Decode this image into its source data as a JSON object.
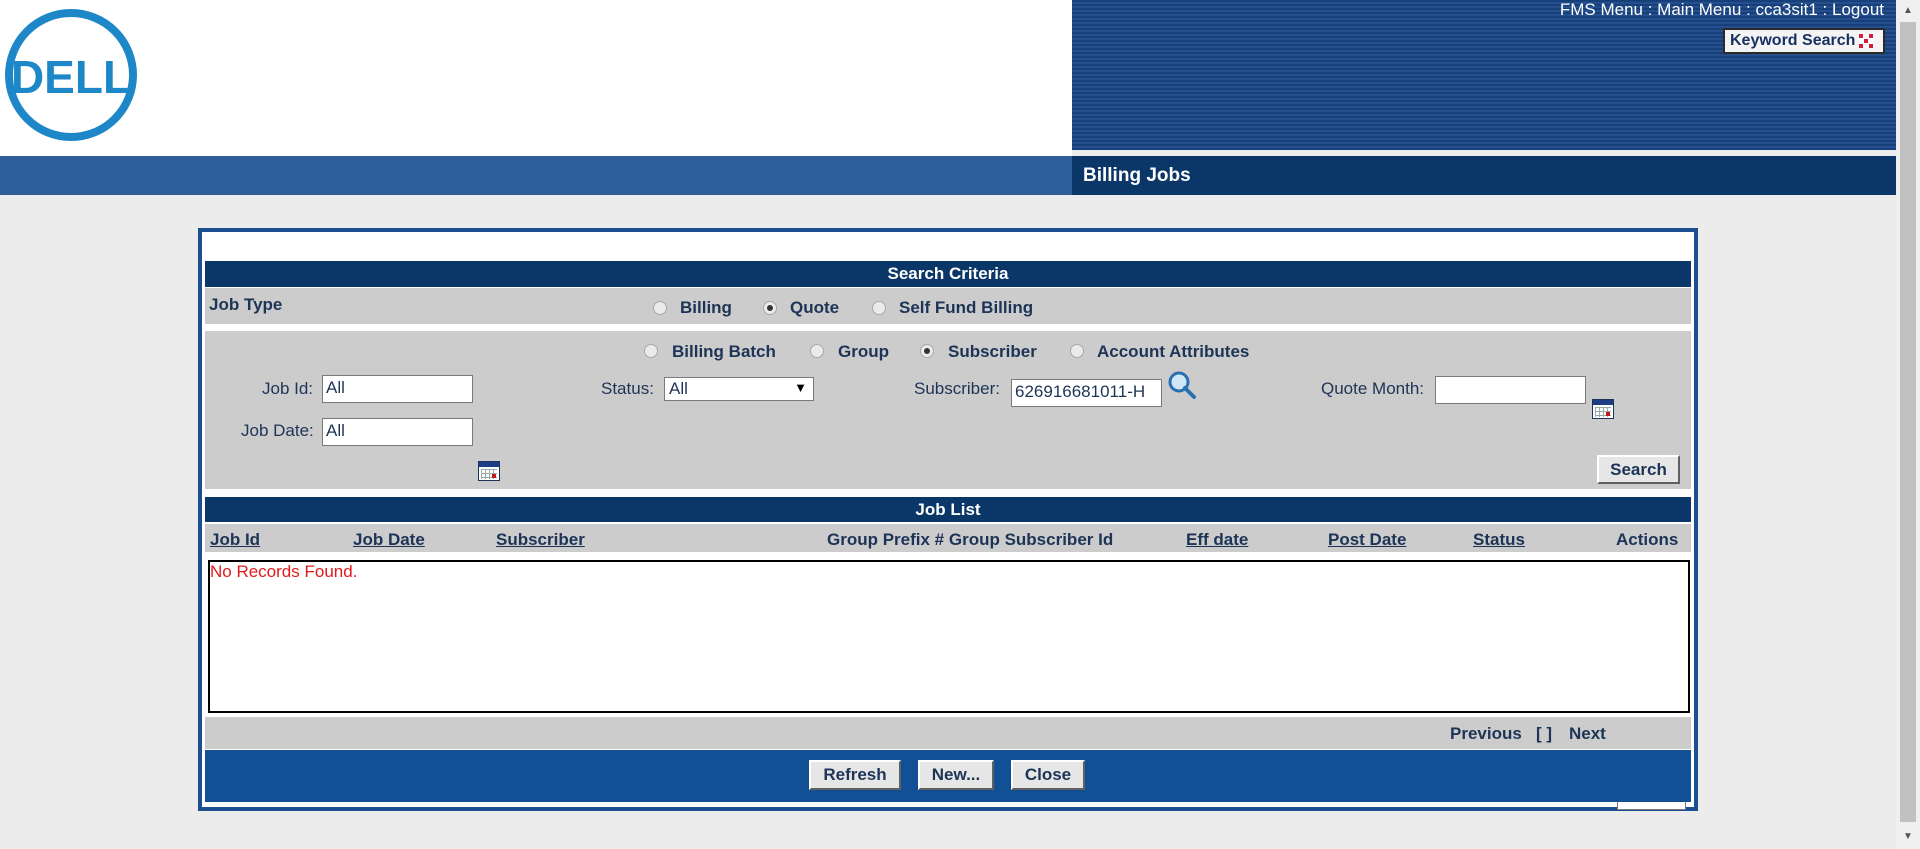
{
  "header": {
    "logo_text": "DELL",
    "links": [
      "FMS Menu",
      "Main Menu",
      "cca3sit1",
      "Logout"
    ],
    "separator": " : ",
    "keyword_search_label": "Keyword Search",
    "page_title": "Billing Jobs"
  },
  "search_criteria": {
    "title": "Search Criteria",
    "job_type_label": "Job Type",
    "job_types": [
      {
        "label": "Billing",
        "selected": false
      },
      {
        "label": "Quote",
        "selected": true
      },
      {
        "label": "Self Fund Billing",
        "selected": false
      }
    ],
    "scope_options": [
      {
        "label": "Billing Batch",
        "selected": false
      },
      {
        "label": "Group",
        "selected": false
      },
      {
        "label": "Subscriber",
        "selected": true
      },
      {
        "label": "Account Attributes",
        "selected": false
      }
    ],
    "job_id_label": "Job Id:",
    "job_id_value": "All",
    "status_label": "Status:",
    "status_value": "All",
    "subscriber_label": "Subscriber:",
    "subscriber_value": "626916681011-H",
    "quote_month_label": "Quote Month:",
    "quote_month_value": "",
    "job_date_label": "Job Date:",
    "job_date_value": "All",
    "search_button": "Search"
  },
  "job_list": {
    "title": "Job List",
    "columns": [
      {
        "label": "Job Id",
        "sortable": true
      },
      {
        "label": "Job Date",
        "sortable": true
      },
      {
        "label": "Subscriber",
        "sortable": true
      },
      {
        "label": "Group Prefix # Group Subscriber Id",
        "sortable": false
      },
      {
        "label": "Eff date",
        "sortable": true
      },
      {
        "label": "Post Date",
        "sortable": true
      },
      {
        "label": "Status",
        "sortable": true
      },
      {
        "label": "Actions",
        "sortable": false
      }
    ],
    "empty_message": "No Records Found.",
    "pagination": {
      "previous": "Previous",
      "pages": "[ ]",
      "next": "Next",
      "page_size": "5"
    }
  },
  "footer_buttons": {
    "refresh": "Refresh",
    "new": "New...",
    "close": "Close"
  },
  "colors": {
    "nav_dark": "#0b3668",
    "nav_light": "#2e5f9b",
    "panel_border": "#1b4f90",
    "error": "#e01b1b",
    "logo_blue": "#1e87c7"
  }
}
